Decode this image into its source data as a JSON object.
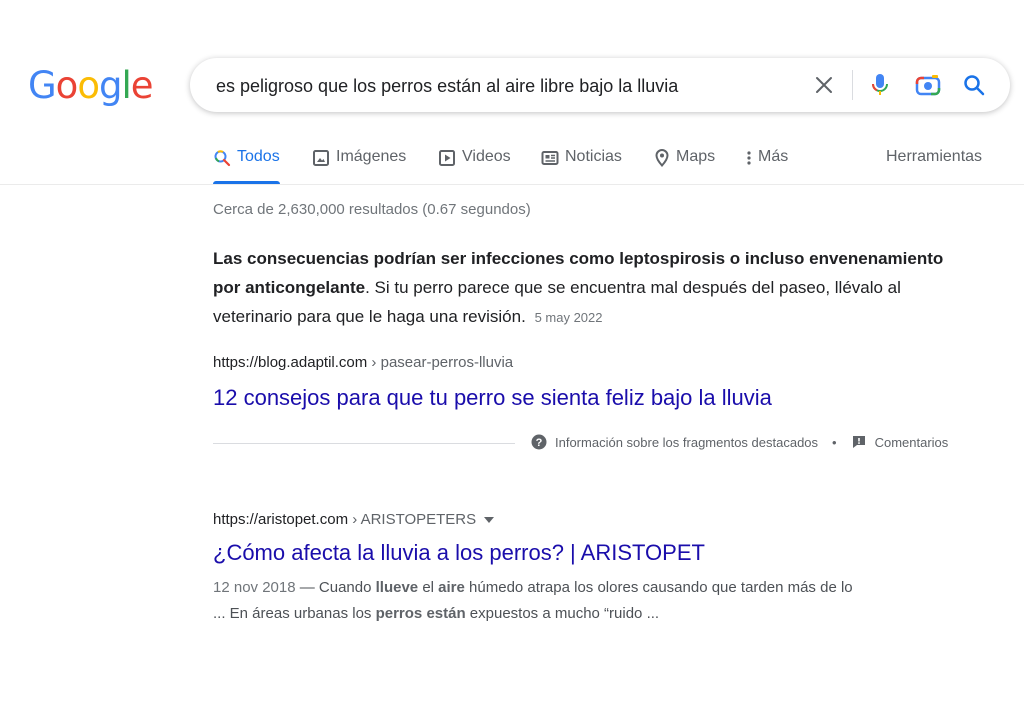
{
  "logo": {
    "letters": [
      "G",
      "o",
      "o",
      "g",
      "l",
      "e"
    ]
  },
  "search": {
    "query": "es peligroso que los perros están al aire libre bajo la lluvia"
  },
  "tabs": [
    {
      "label": "Todos",
      "icon": "search-icon"
    },
    {
      "label": "Imágenes",
      "icon": "image-icon"
    },
    {
      "label": "Videos",
      "icon": "play-icon"
    },
    {
      "label": "Noticias",
      "icon": "news-icon"
    },
    {
      "label": "Maps",
      "icon": "location-pin-icon"
    },
    {
      "label": "Más",
      "icon": "more-vert-icon"
    }
  ],
  "tools_label": "Herramientas",
  "stats": "Cerca de 2,630,000 resultados (0.67 segundos)",
  "featured": {
    "bold": "Las consecuencias podrían ser infecciones como leptospirosis o incluso envenenamiento por anticongelante",
    "rest": ". Si tu perro parece que se encuentra mal después del paseo, llévalo al veterinario para que le haga una revisión.",
    "date": "5 may 2022",
    "cite_host": "https://blog.adaptil.com",
    "cite_path": " › pasear-perros-lluvia",
    "title": "12 consejos para que tu perro se sienta feliz bajo la lluvia",
    "info_label": "Información sobre los fragmentos destacados",
    "dot": "•",
    "feedback_label": "Comentarios"
  },
  "result2": {
    "cite_host": "https://aristopet.com",
    "cite_path": " › ARISTOPETERS",
    "title": "¿Cómo afecta la lluvia a los perros? | ARISTOPET",
    "date": "12 nov 2018",
    "desc": [
      {
        "t": " — Cuando ",
        "b": false
      },
      {
        "t": "llueve",
        "b": true
      },
      {
        "t": " el ",
        "b": false
      },
      {
        "t": "aire",
        "b": true
      },
      {
        "t": " húmedo atrapa los olores causando que tarden más de lo",
        "b": false
      }
    ],
    "desc2": [
      {
        "t": "... En áreas urbanas los ",
        "b": false
      },
      {
        "t": "perros están",
        "b": true
      },
      {
        "t": " expuestos a mucho “ruido ...",
        "b": false
      }
    ]
  },
  "colors": {
    "blue": "#4285f4",
    "red": "#ea4335",
    "yellow": "#fbbc05",
    "green": "#34a853",
    "link": "#1a0dab",
    "accent": "#1a73e8"
  }
}
